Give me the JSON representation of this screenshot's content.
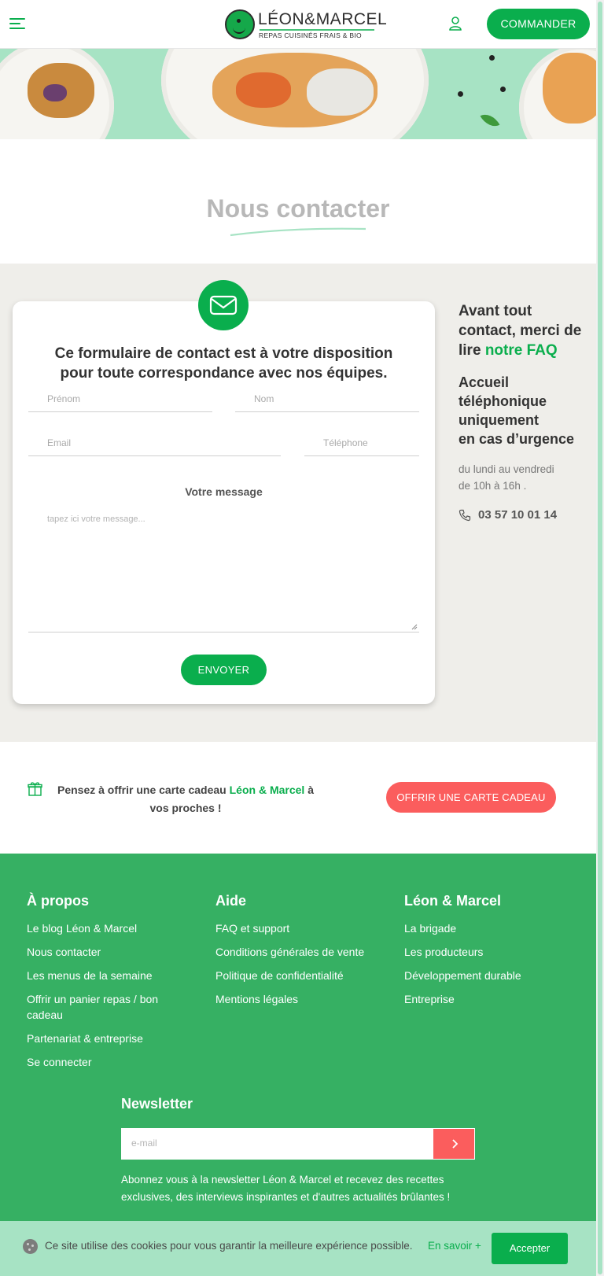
{
  "header": {
    "logo_name": "LÉON&MARCEL",
    "logo_tagline": "REPAS CUISINÉS FRAIS & BIO",
    "order_label": "COMMANDER"
  },
  "page": {
    "title": "Nous contacter"
  },
  "form": {
    "heading": "Ce formulaire de contact est à votre disposition pour toute correspondance avec nos équipes.",
    "first_name_placeholder": "Prénom",
    "last_name_placeholder": "Nom",
    "email_placeholder": "Email",
    "phone_placeholder": "Téléphone",
    "message_label": "Votre message",
    "message_placeholder": "tapez ici votre message...",
    "submit_label": "ENVOYER"
  },
  "side": {
    "faq_intro": "Avant tout contact, merci de lire ",
    "faq_link": "notre FAQ",
    "phone_heading_1": "Accueil téléphonique uniquement",
    "phone_heading_2": "en cas d’urgence",
    "hours_1": "du lundi au vendredi",
    "hours_2": "de 10h à 16h .",
    "phone_number": "03 57 10 01 14"
  },
  "gift": {
    "text_before": "Pensez à offrir une carte cadeau ",
    "brand": "Léon & Marcel",
    "text_after": " à vos proches !",
    "button_label": "OFFRIR UNE CARTE CADEAU"
  },
  "footer": {
    "columns": [
      {
        "title": "À propos",
        "links": [
          "Le blog Léon & Marcel",
          "Nous contacter",
          "Les menus de la semaine",
          "Offrir un panier repas / bon cadeau",
          "Partenariat & entreprise",
          "Se connecter"
        ]
      },
      {
        "title": "Aide",
        "links": [
          "FAQ et support",
          "Conditions générales de vente",
          "Politique de confidentialité",
          "Mentions légales"
        ]
      },
      {
        "title": "Léon & Marcel",
        "links": [
          "La brigade",
          "Les producteurs",
          "Développement durable",
          "Entreprise"
        ]
      }
    ],
    "newsletter": {
      "title": "Newsletter",
      "placeholder": "e-mail",
      "description": "Abonnez vous à la newsletter Léon & Marcel et recevez des recettes exclusives, des interviews inspirantes et d'autres actualités brûlantes !"
    }
  },
  "cookie": {
    "text": "Ce site utilise des cookies pour vous garantir la meilleure expérience possible.",
    "more_label": "En savoir +",
    "accept_label": "Accepter"
  },
  "colors": {
    "brand_green": "#0aae4d",
    "footer_green": "#36b063",
    "mint": "#a7e3c4",
    "coral": "#fb5d5d",
    "section_grey": "#efeeea"
  }
}
